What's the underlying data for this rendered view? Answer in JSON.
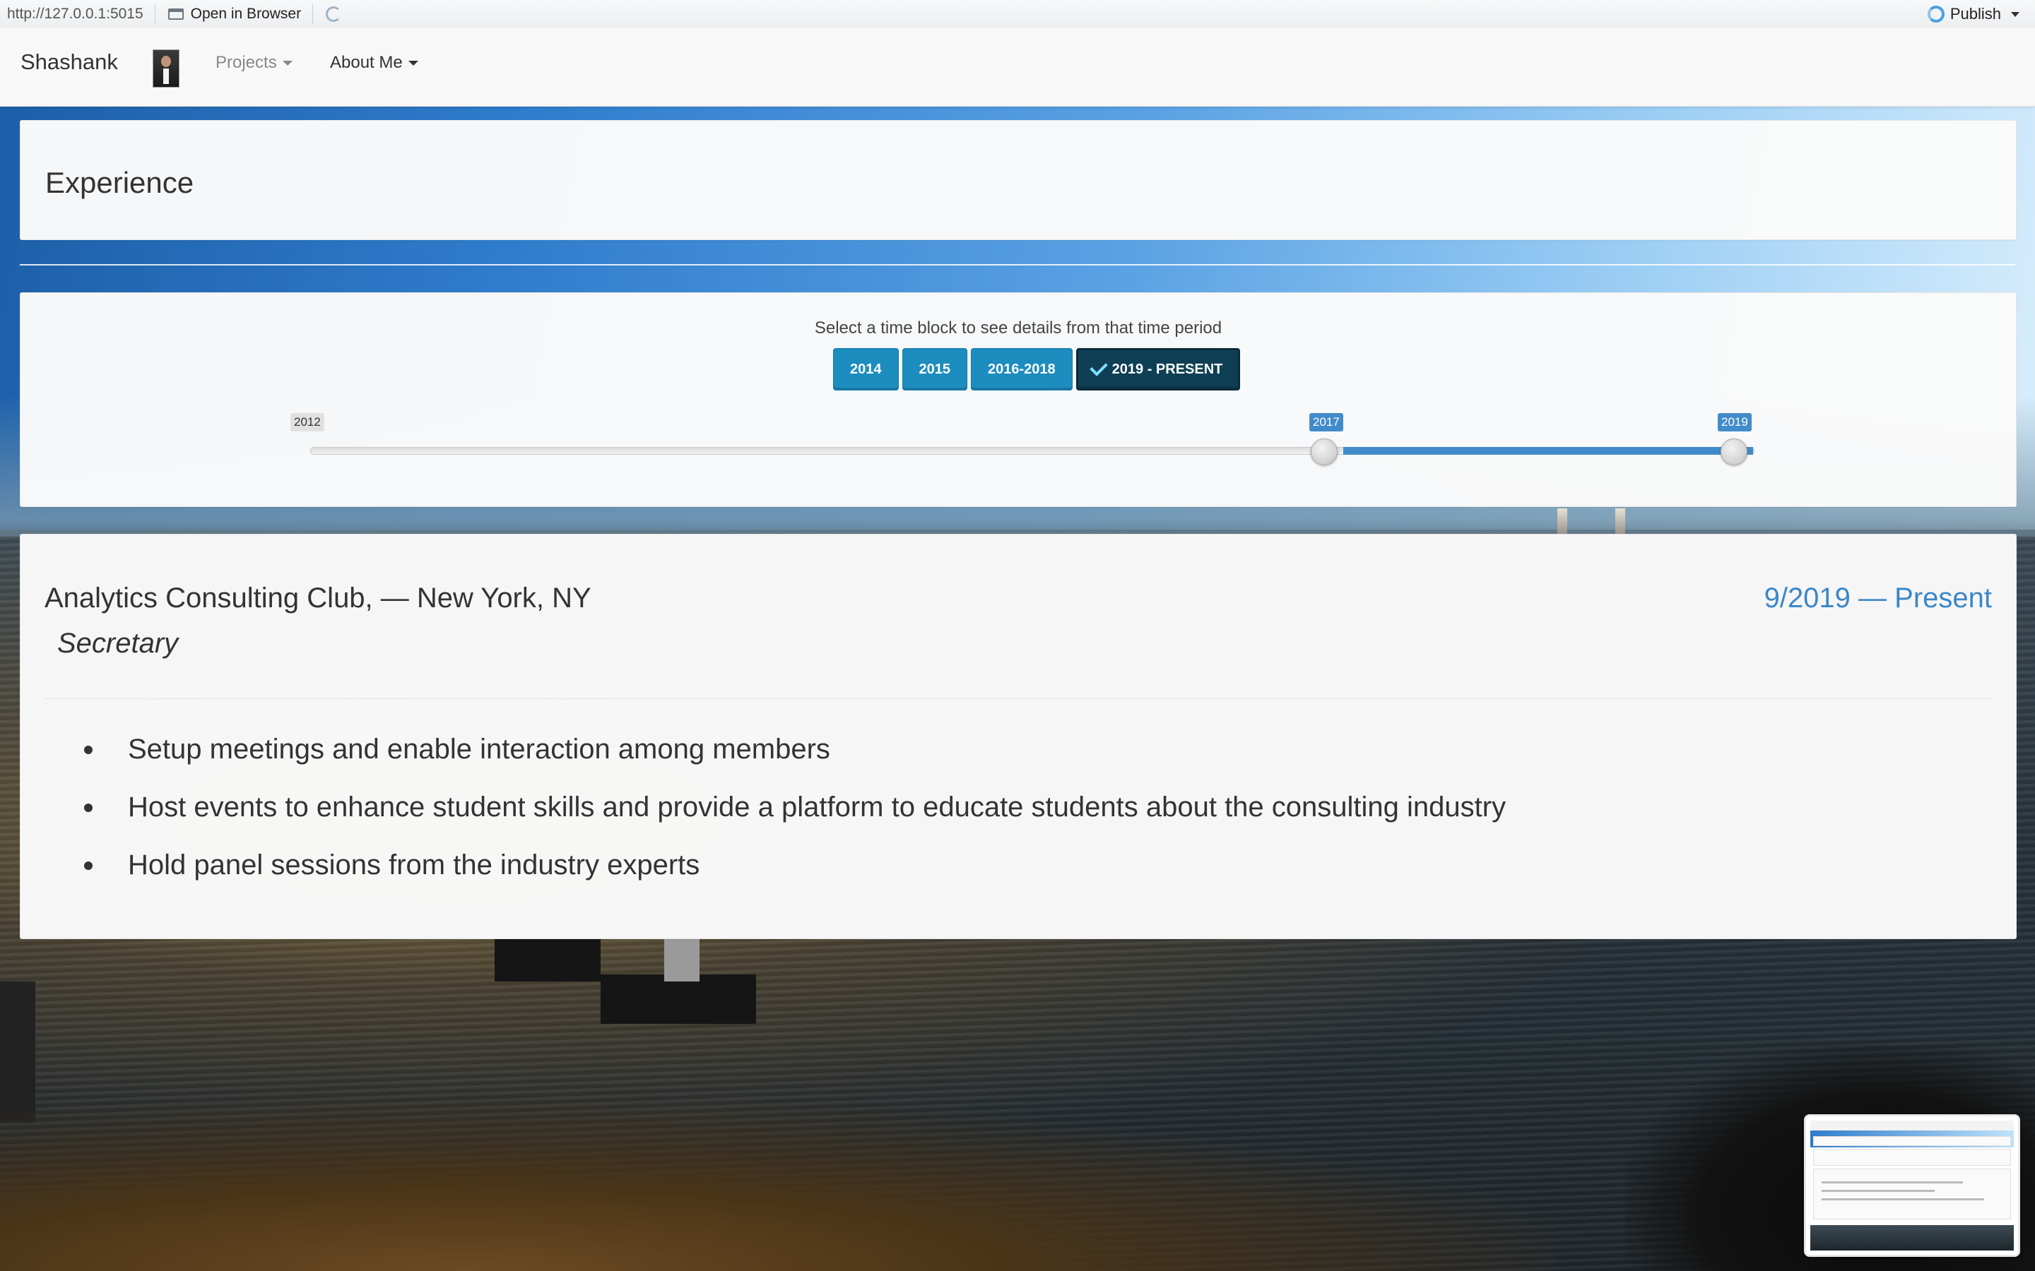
{
  "viewer": {
    "url": "http://127.0.0.1:5015",
    "open_in_browser_label": "Open in Browser",
    "publish_label": "Publish"
  },
  "navbar": {
    "brand": "Shashank",
    "items": [
      {
        "label": "Projects",
        "state": "muted"
      },
      {
        "label": "About Me",
        "state": "normal"
      }
    ]
  },
  "header": {
    "title": "Experience"
  },
  "time_selector": {
    "prompt": "Select a time block to see details from that time period",
    "buttons": [
      "2014",
      "2015",
      "2016-2018",
      "2019 - PRESENT"
    ],
    "selected": "2019 - PRESENT",
    "slider": {
      "min_label": "2012",
      "from_label": "2017",
      "to_label": "2019",
      "min": 2012,
      "max": 2019,
      "from": 2017,
      "to": 2019
    }
  },
  "experience": {
    "organization": "Analytics Consulting Club, — New York, NY",
    "role": "Secretary",
    "dates": "9/2019 — Present",
    "bullets": [
      "Setup meetings and enable interaction among members",
      "Host events to enhance student skills and provide a platform to educate students about the consulting industry",
      "Hold panel sessions from the industry experts"
    ]
  },
  "colors": {
    "accent": "#428bca",
    "button": "#1d8cbf",
    "button_active": "#0f3f55",
    "date_text": "#3a87c8"
  }
}
